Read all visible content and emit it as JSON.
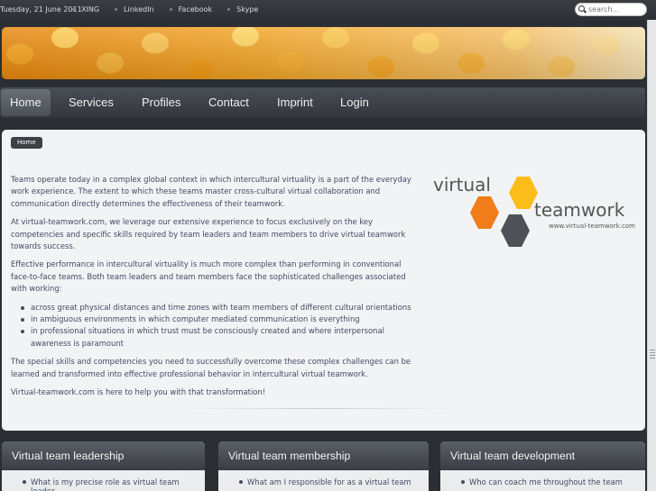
{
  "topbar": {
    "date": "Tuesday, 21 June 2011",
    "links": [
      "XING",
      "LinkedIn",
      "Facebook",
      "Skype"
    ],
    "search_placeholder": "search..."
  },
  "nav": {
    "items": [
      "Home",
      "Services",
      "Profiles",
      "Contact",
      "Imprint",
      "Login"
    ],
    "active": "Home"
  },
  "breadcrumb": "Home",
  "logo": {
    "word1": "virtual",
    "word2": "teamwork",
    "url": "www.virtual-teamwork.com",
    "colors": {
      "orange": "#f07d1a",
      "yellow": "#fbbd18",
      "gray": "#4e5158"
    }
  },
  "content": {
    "p1": "Teams operate today in a complex global context in which intercultural virtuality is a part of the everyday work experience. The extent to which these teams master cross-cultural virtual collaboration and communication directly determines the effectiveness of their teamwork.",
    "p2": "At virtual-teamwork.com, we leverage our extensive experience to focus exclusively on the key competencies and specific skills required by team leaders and team members to drive virtual teamwork towards success.",
    "p3": "Effective performance in intercultural virtuality is much more complex than performing in conventional face-to-face teams. Both team leaders and team members face the sophisticated challenges associated with working:",
    "list": [
      "across great physical distances and time zones with team members of different cultural orientations",
      "in ambiguous environments in which computer mediated communication is everything",
      "in professional situations in which trust must be consciously created and where interpersonal awareness is paramount"
    ],
    "p4": "The special skills and competencies you need to successfully overcome these complex challenges can be learned and transformed into effective professional behavior in intercultural virtual teamwork.",
    "p5": "Virtual-teamwork.com is here to help you with that transformation!"
  },
  "boxes": [
    {
      "title": "Virtual team leadership",
      "item": "What is my precise role as virtual team leader"
    },
    {
      "title": "Virtual team membership",
      "item": "What am I responsible for as a virtual team"
    },
    {
      "title": "Virtual team development",
      "item": "Who can coach me throughout the team"
    }
  ]
}
